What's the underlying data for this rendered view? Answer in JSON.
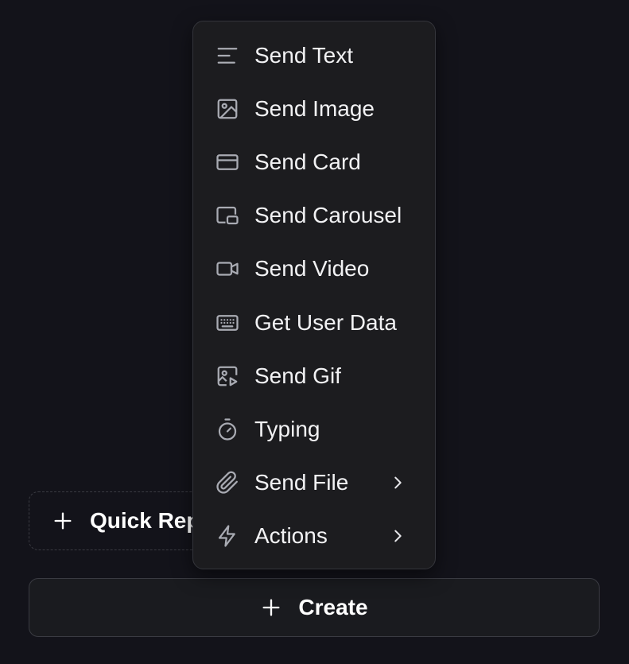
{
  "menu": {
    "items": [
      {
        "label": "Send Text",
        "icon": "text-lines-icon",
        "has_submenu": false
      },
      {
        "label": "Send Image",
        "icon": "image-icon",
        "has_submenu": false
      },
      {
        "label": "Send Card",
        "icon": "card-icon",
        "has_submenu": false
      },
      {
        "label": "Send Carousel",
        "icon": "carousel-icon",
        "has_submenu": false
      },
      {
        "label": "Send Video",
        "icon": "video-camera-icon",
        "has_submenu": false
      },
      {
        "label": "Get User Data",
        "icon": "keyboard-icon",
        "has_submenu": false
      },
      {
        "label": "Send Gif",
        "icon": "gif-image-play-icon",
        "has_submenu": false
      },
      {
        "label": "Typing",
        "icon": "stopwatch-icon",
        "has_submenu": false
      },
      {
        "label": "Send File",
        "icon": "paperclip-icon",
        "has_submenu": true
      },
      {
        "label": "Actions",
        "icon": "lightning-bolt-icon",
        "has_submenu": true
      }
    ]
  },
  "quick_reply": {
    "label": "Quick Rep",
    "icon": "plus-icon"
  },
  "create": {
    "label": "Create",
    "icon": "plus-icon"
  },
  "colors": {
    "background": "#13131a",
    "menu_background": "#1c1c1f",
    "border": "#3a3b42",
    "icon": "#a9abb3",
    "text": "#f2f2f4"
  }
}
